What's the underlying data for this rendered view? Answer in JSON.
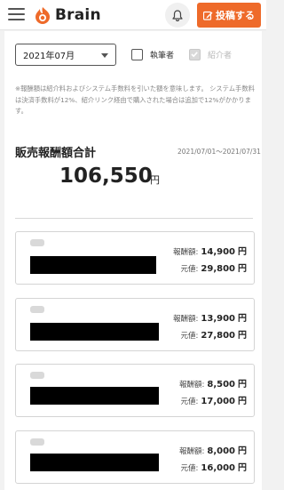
{
  "header": {
    "brand_name": "Brain",
    "post_button_label": "投稿する",
    "icons": {
      "menu": "hamburger-icon",
      "logo": "brain-flame-logo",
      "bell": "bell-icon",
      "post": "edit-icon"
    },
    "accent_color": "#ee6a2a"
  },
  "filters": {
    "month_value": "2021年07月",
    "author_checkbox": {
      "label": "執筆者",
      "checked": false
    },
    "introducer_checkbox": {
      "label": "紹介者",
      "checked": true,
      "disabled": true
    }
  },
  "note": "※報酬額は紹介料およびシステム手数料を引いた額を意味します。 システム手数料は決済手数料が12%、紹介リンク経由で購入された場合は追加で12%がかかります。",
  "summary": {
    "title": "販売報酬額合計",
    "period": "2021/07/01〜2021/07/31",
    "total": "106,550",
    "currency": "円"
  },
  "sales": [
    {
      "reward_label": "報酬額:",
      "reward": "14,900",
      "price_label": "元値:",
      "price": "29,800",
      "currency": "円"
    },
    {
      "reward_label": "報酬額:",
      "reward": "13,900",
      "price_label": "元値:",
      "price": "27,800",
      "currency": "円"
    },
    {
      "reward_label": "報酬額:",
      "reward": "8,500",
      "price_label": "元値:",
      "price": "17,000",
      "currency": "円"
    },
    {
      "reward_label": "報酬額:",
      "reward": "8,000",
      "price_label": "元値:",
      "price": "16,000",
      "currency": "円"
    }
  ]
}
